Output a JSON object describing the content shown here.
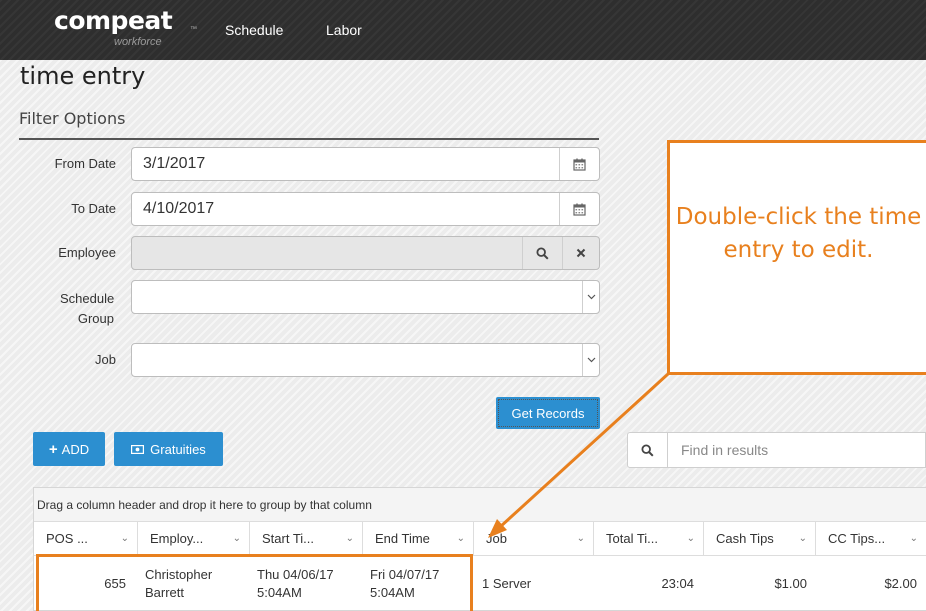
{
  "header": {
    "logo": "compeat",
    "logo_tm": "™",
    "logo_sub": "workforce",
    "nav": [
      "Schedule",
      "Labor"
    ]
  },
  "page": {
    "title": "time entry",
    "filter_title": "Filter Options"
  },
  "filters": {
    "from_date_label": "From Date",
    "from_date_value": "3/1/2017",
    "to_date_label": "To Date",
    "to_date_value": "4/10/2017",
    "employee_label": "Employee",
    "employee_value": "",
    "schedule_group_label": "Schedule Group",
    "schedule_group_value": "",
    "job_label": "Job",
    "job_value": ""
  },
  "buttons": {
    "get_records": "Get Records",
    "add": "ADD",
    "gratuities": "Gratuities"
  },
  "search": {
    "placeholder": "Find in results"
  },
  "grid": {
    "group_hint": "Drag a column header and drop it here to group by that column",
    "columns": [
      "POS ...",
      "Employ...",
      "Start Ti...",
      "End Time",
      "Job",
      "Total Ti...",
      "Cash Tips",
      "CC Tips..."
    ],
    "rows": [
      {
        "pos": "655",
        "employee": "Christopher Barrett",
        "start_day": "Thu 04/06/17",
        "start_time": "5:04AM",
        "end_day": "Fri 04/07/17",
        "end_time": "5:04AM",
        "job": "1 Server",
        "total_time": "23:04",
        "cash_tips": "$1.00",
        "cc_tips": "$2.00"
      }
    ]
  },
  "callout": {
    "text": "Double-click the time entry to edit."
  },
  "colors": {
    "accent_orange": "#e8801e",
    "primary_blue": "#2c8fd0",
    "topbar": "#2e2e2e"
  }
}
